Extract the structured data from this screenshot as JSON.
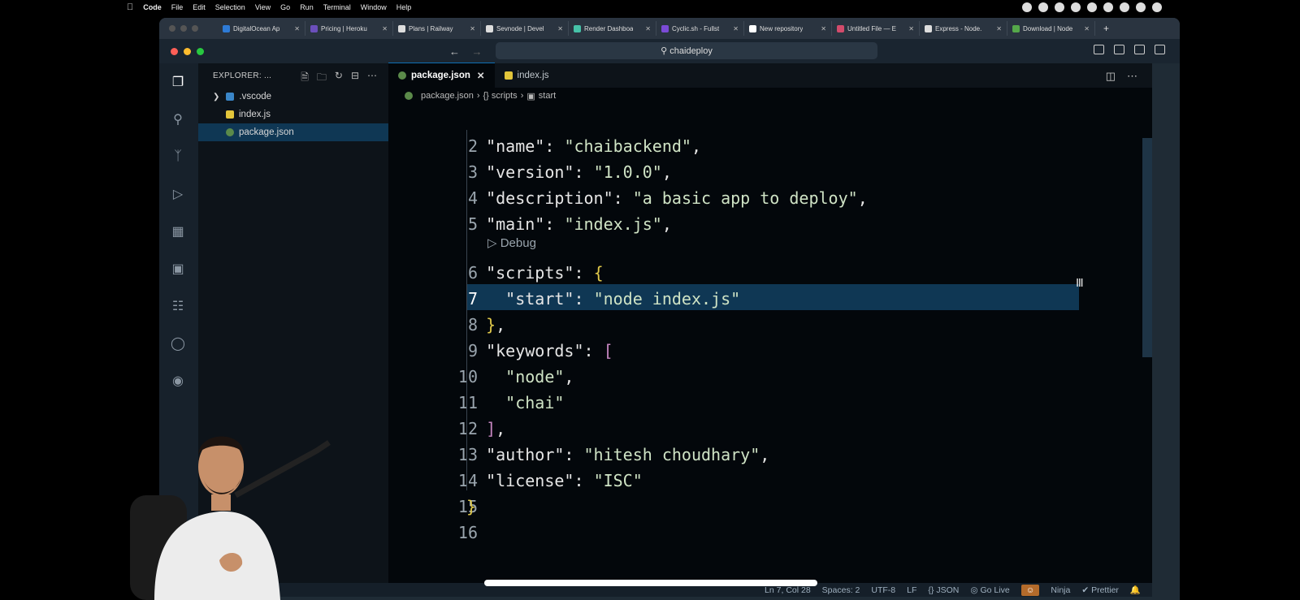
{
  "menubar": {
    "app": "Code",
    "items": [
      "File",
      "Edit",
      "Selection",
      "View",
      "Go",
      "Run",
      "Terminal",
      "Window",
      "Help"
    ]
  },
  "browser_tabs": [
    {
      "label": "DigitalOcean Ap",
      "color": "#2e7bd6"
    },
    {
      "label": "Pricing | Heroku",
      "color": "#6b4fbb"
    },
    {
      "label": "Plans | Railway",
      "color": "#dddddd"
    },
    {
      "label": "Sevnode | Devel",
      "color": "#dddddd"
    },
    {
      "label": "Render Dashboa",
      "color": "#46c2a8"
    },
    {
      "label": "Cyclic.sh - Fullst",
      "color": "#7b4bd6"
    },
    {
      "label": "New repository",
      "color": "#ffffff"
    },
    {
      "label": "Untitled File — E",
      "color": "#d34b6b"
    },
    {
      "label": "Express - Node.",
      "color": "#dddddd"
    },
    {
      "label": "Download | Node",
      "color": "#55a84a"
    }
  ],
  "command_center": "chaideploy",
  "sidebar": {
    "title": "EXPLORER: ...",
    "items": [
      {
        "label": ".vscode",
        "type": "folder"
      },
      {
        "label": "index.js",
        "type": "js"
      },
      {
        "label": "package.json",
        "type": "json"
      }
    ]
  },
  "editor_tabs": [
    {
      "label": "package.json",
      "active": true
    },
    {
      "label": "index.js",
      "active": false
    }
  ],
  "breadcrumb": [
    "package.json",
    "{} scripts",
    "start"
  ],
  "code_lines": [
    {
      "n": "2",
      "indent": "  ",
      "parts": [
        [
          "key",
          "\"name\""
        ],
        [
          "p",
          ": "
        ],
        [
          "str",
          "\"chaibackend\""
        ],
        [
          "p",
          ","
        ]
      ]
    },
    {
      "n": "3",
      "indent": "  ",
      "parts": [
        [
          "key",
          "\"version\""
        ],
        [
          "p",
          ": "
        ],
        [
          "str",
          "\"1.0.0\""
        ],
        [
          "p",
          ","
        ]
      ]
    },
    {
      "n": "4",
      "indent": "  ",
      "parts": [
        [
          "key",
          "\"description\""
        ],
        [
          "p",
          ": "
        ],
        [
          "str",
          "\"a basic app to deploy\""
        ],
        [
          "p",
          ","
        ]
      ]
    },
    {
      "n": "5",
      "indent": "  ",
      "parts": [
        [
          "key",
          "\"main\""
        ],
        [
          "p",
          ": "
        ],
        [
          "str",
          "\"index.js\""
        ],
        [
          "p",
          ","
        ]
      ]
    },
    {
      "n": "6",
      "indent": "  ",
      "parts": [
        [
          "key",
          "\"scripts\""
        ],
        [
          "p",
          ": "
        ],
        [
          "brace",
          "{"
        ]
      ]
    },
    {
      "n": "7",
      "indent": "    ",
      "parts": [
        [
          "key",
          "\"start\""
        ],
        [
          "p",
          ": "
        ],
        [
          "str",
          "\"node index.js\""
        ]
      ]
    },
    {
      "n": "8",
      "indent": "  ",
      "parts": [
        [
          "brace",
          "}"
        ],
        [
          "p",
          ","
        ]
      ]
    },
    {
      "n": "9",
      "indent": "  ",
      "parts": [
        [
          "key",
          "\"keywords\""
        ],
        [
          "p",
          ": "
        ],
        [
          "bracket",
          "["
        ]
      ]
    },
    {
      "n": "10",
      "indent": "    ",
      "parts": [
        [
          "str",
          "\"node\""
        ],
        [
          "p",
          ","
        ]
      ]
    },
    {
      "n": "11",
      "indent": "    ",
      "parts": [
        [
          "str",
          "\"chai\""
        ]
      ]
    },
    {
      "n": "12",
      "indent": "  ",
      "parts": [
        [
          "bracket",
          "]"
        ],
        [
          "p",
          ","
        ]
      ]
    },
    {
      "n": "13",
      "indent": "  ",
      "parts": [
        [
          "key",
          "\"author\""
        ],
        [
          "p",
          ": "
        ],
        [
          "str",
          "\"hitesh choudhary\""
        ],
        [
          "p",
          ","
        ]
      ]
    },
    {
      "n": "14",
      "indent": "  ",
      "parts": [
        [
          "key",
          "\"license\""
        ],
        [
          "p",
          ": "
        ],
        [
          "str",
          "\"ISC\""
        ]
      ]
    },
    {
      "n": "15",
      "indent": "",
      "parts": [
        [
          "brace",
          "}"
        ]
      ]
    },
    {
      "n": "16",
      "indent": "",
      "parts": []
    }
  ],
  "codelens": "▷ Debug",
  "current_line": "7",
  "status": {
    "position": "Ln 7, Col 28",
    "spaces": "Spaces: 2",
    "encoding": "UTF-8",
    "eol": "LF",
    "language": "{} JSON",
    "golive": "Go Live",
    "ninja": "Ninja",
    "prettier": "✔ Prettier"
  },
  "colors": {
    "accent": "#0e6fb4",
    "selection": "#0f3754"
  },
  "icons": [
    "explorer-icon",
    "search-icon",
    "source-control-icon",
    "run-debug-icon",
    "extensions-icon",
    "remote-explorer-icon",
    "docker-icon",
    "github-icon",
    "bell-icon"
  ]
}
